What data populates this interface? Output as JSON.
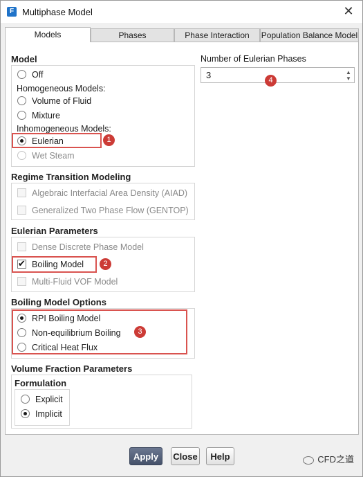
{
  "window": {
    "title": "Multiphase Model",
    "icon_letter": "F",
    "close_glyph": "✕"
  },
  "tabs": [
    {
      "label": "Models",
      "active": true
    },
    {
      "label": "Phases",
      "active": false
    },
    {
      "label": "Phase Interaction",
      "active": false
    },
    {
      "label": "Population Balance Model",
      "active": false
    }
  ],
  "model": {
    "heading": "Model",
    "off": "Off",
    "homogeneous_label": "Homogeneous Models:",
    "vof": "Volume of Fluid",
    "mixture": "Mixture",
    "inhomogeneous_label": "Inhomogeneous Models:",
    "eulerian": "Eulerian",
    "wet_steam": "Wet Steam",
    "selected": "Eulerian"
  },
  "eulerian_phases": {
    "label": "Number of Eulerian Phases",
    "value": "3"
  },
  "regime": {
    "heading": "Regime Transition Modeling",
    "aiad": "Algebraic Interfacial Area Density (AIAD)",
    "gentop": "Generalized Two Phase Flow (GENTOP)"
  },
  "eulerian_params": {
    "heading": "Eulerian Parameters",
    "dense_dpm": "Dense Discrete Phase Model",
    "boiling": "Boiling Model",
    "boiling_checked": true,
    "multi_fluid_vof": "Multi-Fluid VOF Model"
  },
  "boiling_options": {
    "heading": "Boiling Model Options",
    "rpi": "RPI Boiling Model",
    "non_eq": "Non-equilibrium Boiling",
    "chf": "Critical Heat Flux",
    "selected": "RPI Boiling Model"
  },
  "volume_fraction": {
    "heading": "Volume Fraction Parameters",
    "formulation_heading": "Formulation",
    "explicit": "Explicit",
    "implicit": "Implicit",
    "selected": "Implicit"
  },
  "annotations": [
    "1",
    "2",
    "3",
    "4"
  ],
  "buttons": {
    "apply": "Apply",
    "close": "Close",
    "help": "Help"
  },
  "watermark": "CFD之道",
  "colors": {
    "annotation": "#cc3b36",
    "apply_button": "#46526a",
    "app_icon": "#1f73c9"
  }
}
